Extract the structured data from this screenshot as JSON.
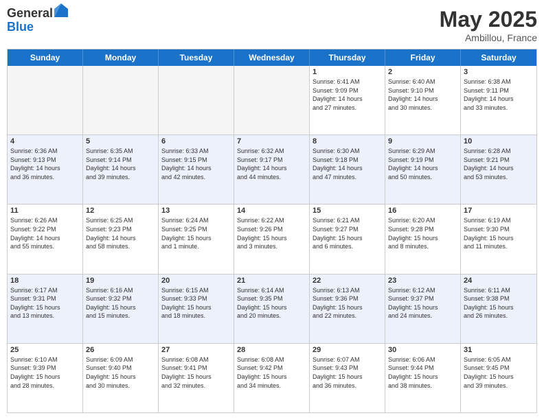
{
  "logo": {
    "general": "General",
    "blue": "Blue"
  },
  "title": "May 2025",
  "location": "Ambillou, France",
  "header_days": [
    "Sunday",
    "Monday",
    "Tuesday",
    "Wednesday",
    "Thursday",
    "Friday",
    "Saturday"
  ],
  "rows": [
    {
      "cells": [
        {
          "day": "",
          "info": "",
          "empty": true
        },
        {
          "day": "",
          "info": "",
          "empty": true
        },
        {
          "day": "",
          "info": "",
          "empty": true
        },
        {
          "day": "",
          "info": "",
          "empty": true
        },
        {
          "day": "1",
          "info": "Sunrise: 6:41 AM\nSunset: 9:09 PM\nDaylight: 14 hours\nand 27 minutes.",
          "empty": false
        },
        {
          "day": "2",
          "info": "Sunrise: 6:40 AM\nSunset: 9:10 PM\nDaylight: 14 hours\nand 30 minutes.",
          "empty": false
        },
        {
          "day": "3",
          "info": "Sunrise: 6:38 AM\nSunset: 9:11 PM\nDaylight: 14 hours\nand 33 minutes.",
          "empty": false
        }
      ],
      "alt": false
    },
    {
      "cells": [
        {
          "day": "4",
          "info": "Sunrise: 6:36 AM\nSunset: 9:13 PM\nDaylight: 14 hours\nand 36 minutes.",
          "empty": false
        },
        {
          "day": "5",
          "info": "Sunrise: 6:35 AM\nSunset: 9:14 PM\nDaylight: 14 hours\nand 39 minutes.",
          "empty": false
        },
        {
          "day": "6",
          "info": "Sunrise: 6:33 AM\nSunset: 9:15 PM\nDaylight: 14 hours\nand 42 minutes.",
          "empty": false
        },
        {
          "day": "7",
          "info": "Sunrise: 6:32 AM\nSunset: 9:17 PM\nDaylight: 14 hours\nand 44 minutes.",
          "empty": false
        },
        {
          "day": "8",
          "info": "Sunrise: 6:30 AM\nSunset: 9:18 PM\nDaylight: 14 hours\nand 47 minutes.",
          "empty": false
        },
        {
          "day": "9",
          "info": "Sunrise: 6:29 AM\nSunset: 9:19 PM\nDaylight: 14 hours\nand 50 minutes.",
          "empty": false
        },
        {
          "day": "10",
          "info": "Sunrise: 6:28 AM\nSunset: 9:21 PM\nDaylight: 14 hours\nand 53 minutes.",
          "empty": false
        }
      ],
      "alt": true
    },
    {
      "cells": [
        {
          "day": "11",
          "info": "Sunrise: 6:26 AM\nSunset: 9:22 PM\nDaylight: 14 hours\nand 55 minutes.",
          "empty": false
        },
        {
          "day": "12",
          "info": "Sunrise: 6:25 AM\nSunset: 9:23 PM\nDaylight: 14 hours\nand 58 minutes.",
          "empty": false
        },
        {
          "day": "13",
          "info": "Sunrise: 6:24 AM\nSunset: 9:25 PM\nDaylight: 15 hours\nand 1 minute.",
          "empty": false
        },
        {
          "day": "14",
          "info": "Sunrise: 6:22 AM\nSunset: 9:26 PM\nDaylight: 15 hours\nand 3 minutes.",
          "empty": false
        },
        {
          "day": "15",
          "info": "Sunrise: 6:21 AM\nSunset: 9:27 PM\nDaylight: 15 hours\nand 6 minutes.",
          "empty": false
        },
        {
          "day": "16",
          "info": "Sunrise: 6:20 AM\nSunset: 9:28 PM\nDaylight: 15 hours\nand 8 minutes.",
          "empty": false
        },
        {
          "day": "17",
          "info": "Sunrise: 6:19 AM\nSunset: 9:30 PM\nDaylight: 15 hours\nand 11 minutes.",
          "empty": false
        }
      ],
      "alt": false
    },
    {
      "cells": [
        {
          "day": "18",
          "info": "Sunrise: 6:17 AM\nSunset: 9:31 PM\nDaylight: 15 hours\nand 13 minutes.",
          "empty": false
        },
        {
          "day": "19",
          "info": "Sunrise: 6:16 AM\nSunset: 9:32 PM\nDaylight: 15 hours\nand 15 minutes.",
          "empty": false
        },
        {
          "day": "20",
          "info": "Sunrise: 6:15 AM\nSunset: 9:33 PM\nDaylight: 15 hours\nand 18 minutes.",
          "empty": false
        },
        {
          "day": "21",
          "info": "Sunrise: 6:14 AM\nSunset: 9:35 PM\nDaylight: 15 hours\nand 20 minutes.",
          "empty": false
        },
        {
          "day": "22",
          "info": "Sunrise: 6:13 AM\nSunset: 9:36 PM\nDaylight: 15 hours\nand 22 minutes.",
          "empty": false
        },
        {
          "day": "23",
          "info": "Sunrise: 6:12 AM\nSunset: 9:37 PM\nDaylight: 15 hours\nand 24 minutes.",
          "empty": false
        },
        {
          "day": "24",
          "info": "Sunrise: 6:11 AM\nSunset: 9:38 PM\nDaylight: 15 hours\nand 26 minutes.",
          "empty": false
        }
      ],
      "alt": true
    },
    {
      "cells": [
        {
          "day": "25",
          "info": "Sunrise: 6:10 AM\nSunset: 9:39 PM\nDaylight: 15 hours\nand 28 minutes.",
          "empty": false
        },
        {
          "day": "26",
          "info": "Sunrise: 6:09 AM\nSunset: 9:40 PM\nDaylight: 15 hours\nand 30 minutes.",
          "empty": false
        },
        {
          "day": "27",
          "info": "Sunrise: 6:08 AM\nSunset: 9:41 PM\nDaylight: 15 hours\nand 32 minutes.",
          "empty": false
        },
        {
          "day": "28",
          "info": "Sunrise: 6:08 AM\nSunset: 9:42 PM\nDaylight: 15 hours\nand 34 minutes.",
          "empty": false
        },
        {
          "day": "29",
          "info": "Sunrise: 6:07 AM\nSunset: 9:43 PM\nDaylight: 15 hours\nand 36 minutes.",
          "empty": false
        },
        {
          "day": "30",
          "info": "Sunrise: 6:06 AM\nSunset: 9:44 PM\nDaylight: 15 hours\nand 38 minutes.",
          "empty": false
        },
        {
          "day": "31",
          "info": "Sunrise: 6:05 AM\nSunset: 9:45 PM\nDaylight: 15 hours\nand 39 minutes.",
          "empty": false
        }
      ],
      "alt": false
    }
  ]
}
